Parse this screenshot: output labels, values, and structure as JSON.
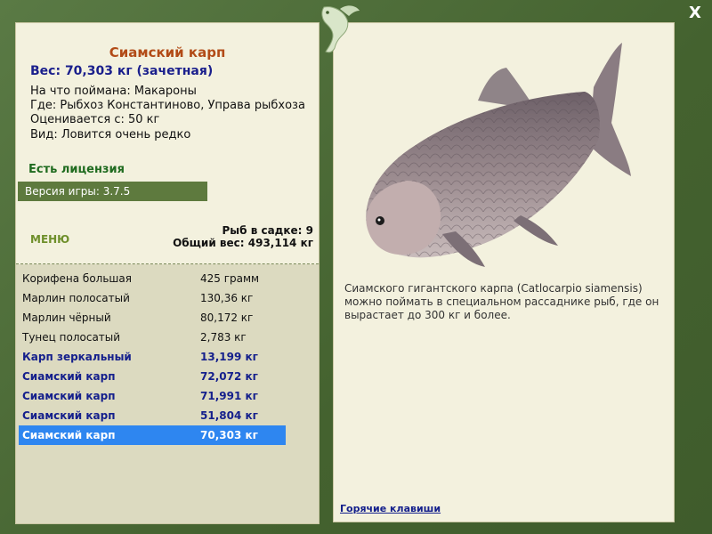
{
  "window": {
    "close_label": "X"
  },
  "fish": {
    "name": "Сиамский карп",
    "weight_line": "Вес: 70,303 кг (зачетная)",
    "caught_on": "На что поймана: Макароны",
    "location": "Где: Рыбхоз Константиново, Управа рыбхоза",
    "valued_from": "Оценивается с: 50 кг",
    "rarity": "Вид: Ловится очень редко"
  },
  "license": "Есть лицензия",
  "version": "Версия игры: 3.7.5",
  "menu_label": "МЕНЮ",
  "sadok": {
    "count": "Рыб в садке: 9",
    "total": "Общий вес: 493,114 кг"
  },
  "catch_list": [
    {
      "name": "Корифена большая",
      "weight": "425 грамм"
    },
    {
      "name": "Марлин полосатый",
      "weight": "130,36 кг"
    },
    {
      "name": "Марлин чёрный",
      "weight": "80,172 кг"
    },
    {
      "name": "Тунец полосатый",
      "weight": "2,783 кг"
    },
    {
      "name": "Карп зеркальный",
      "weight": "13,199 кг"
    },
    {
      "name": "Сиамский карп",
      "weight": "72,072 кг"
    },
    {
      "name": "Сиамский карп",
      "weight": "71,991 кг"
    },
    {
      "name": "Сиамский карп",
      "weight": "51,804 кг"
    },
    {
      "name": "Сиамский карп",
      "weight": "70,303 кг"
    }
  ],
  "description": "Сиамского гигантского карпа (Catlocarpio siamensis) можно поймать в специальном рассаднике рыб, где он вырастает до 300 кг и более.",
  "hotkeys_label": "Горячие клавиши",
  "colors": {
    "frame": "#4d6b3b",
    "panel": "#f3f1de",
    "selected_row": "#2e86f0",
    "title": "#b24b17",
    "weight": "#1a1f8c"
  }
}
